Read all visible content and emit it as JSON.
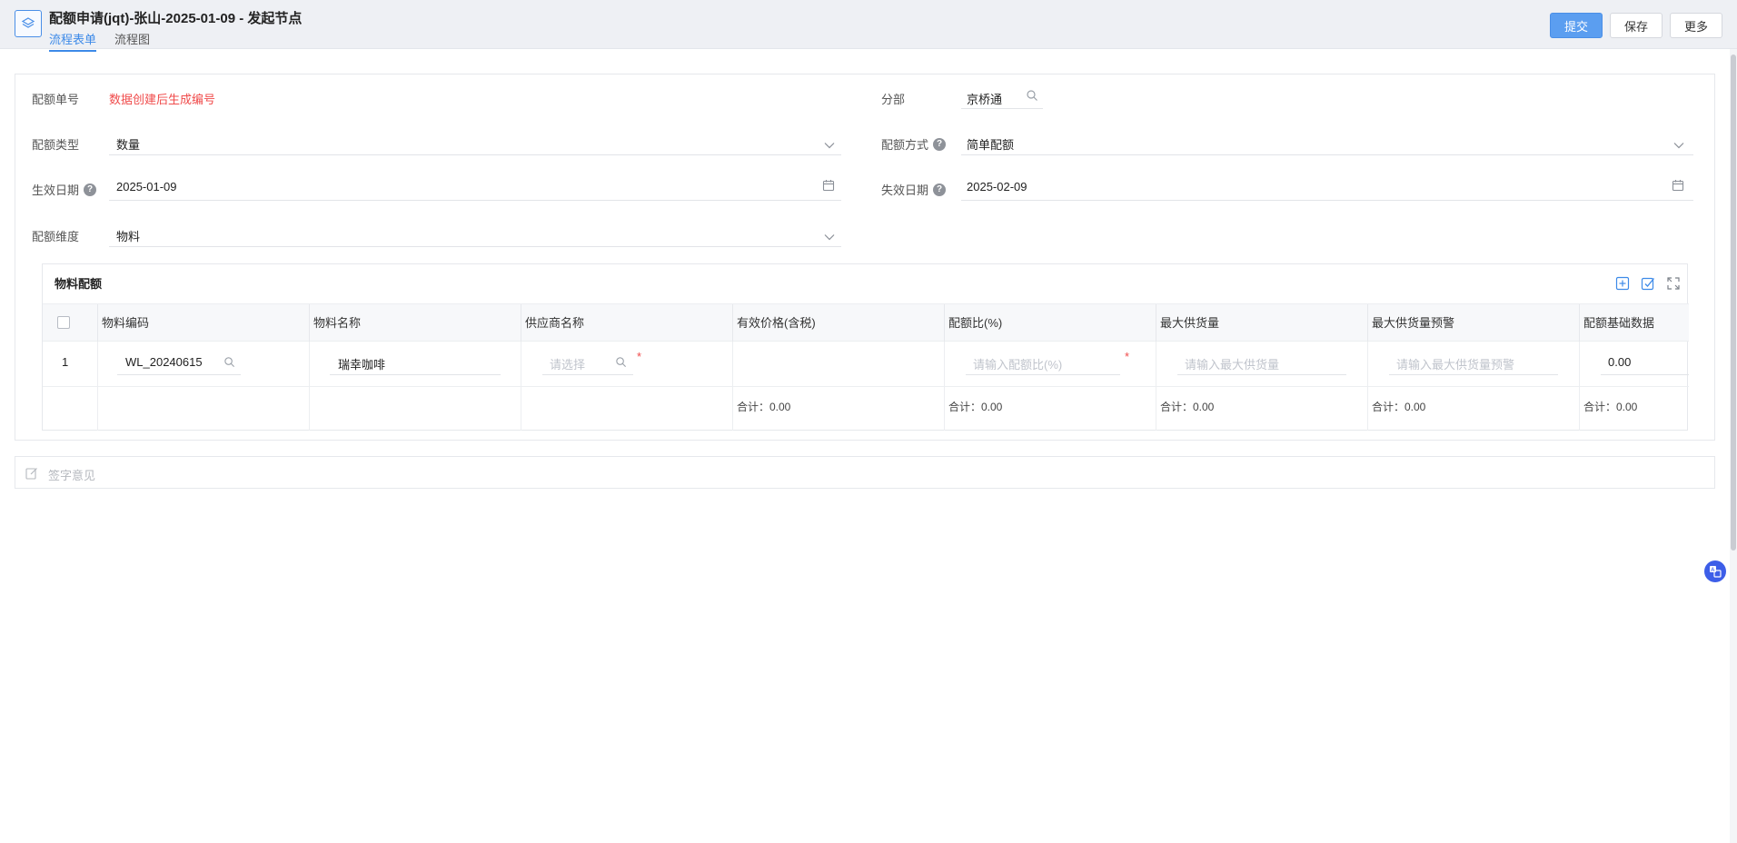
{
  "header": {
    "title": "配额申请(jqt)-张山-2025-01-09 - 发起节点",
    "tabs": {
      "form": "流程表单",
      "flow": "流程图"
    },
    "buttons": {
      "submit": "提交",
      "save": "保存",
      "more": "更多"
    },
    "accent_color": "#3d8ae8"
  },
  "form": {
    "quota_no": {
      "label": "配额单号",
      "value": "数据创建后生成编号"
    },
    "branch": {
      "label": "分部",
      "value": "京桥通"
    },
    "quota_type": {
      "label": "配额类型",
      "value": "数量"
    },
    "quota_method": {
      "label": "配额方式",
      "value": "简单配额"
    },
    "effective_date": {
      "label": "生效日期",
      "value": "2025-01-09"
    },
    "expiry_date": {
      "label": "失效日期",
      "value": "2025-02-09"
    },
    "quota_dimension": {
      "label": "配额维度",
      "value": "物料"
    }
  },
  "table": {
    "title": "物料配额",
    "columns": [
      "物料编码",
      "物料名称",
      "供应商名称",
      "有效价格(含税)",
      "配额比(%)",
      "最大供货量",
      "最大供货量预警",
      "配额基础数据"
    ],
    "rows": [
      {
        "index": "1",
        "material_code": "WL_20240615",
        "material_name": "瑞幸咖啡",
        "supplier_placeholder": "请选择",
        "ratio_placeholder": "请输入配额比(%)",
        "max_supply_placeholder": "请输入最大供货量",
        "max_warn_placeholder": "请输入最大供货量预警",
        "base_data": "0.00"
      }
    ],
    "totals": {
      "price": "合计：0.00",
      "ratio": "合计：0.00",
      "max_supply": "合计：0.00",
      "max_warn": "合计：0.00",
      "base": "合计：0.00"
    },
    "required_mark": "*"
  },
  "signature": {
    "placeholder": "签字意见"
  }
}
